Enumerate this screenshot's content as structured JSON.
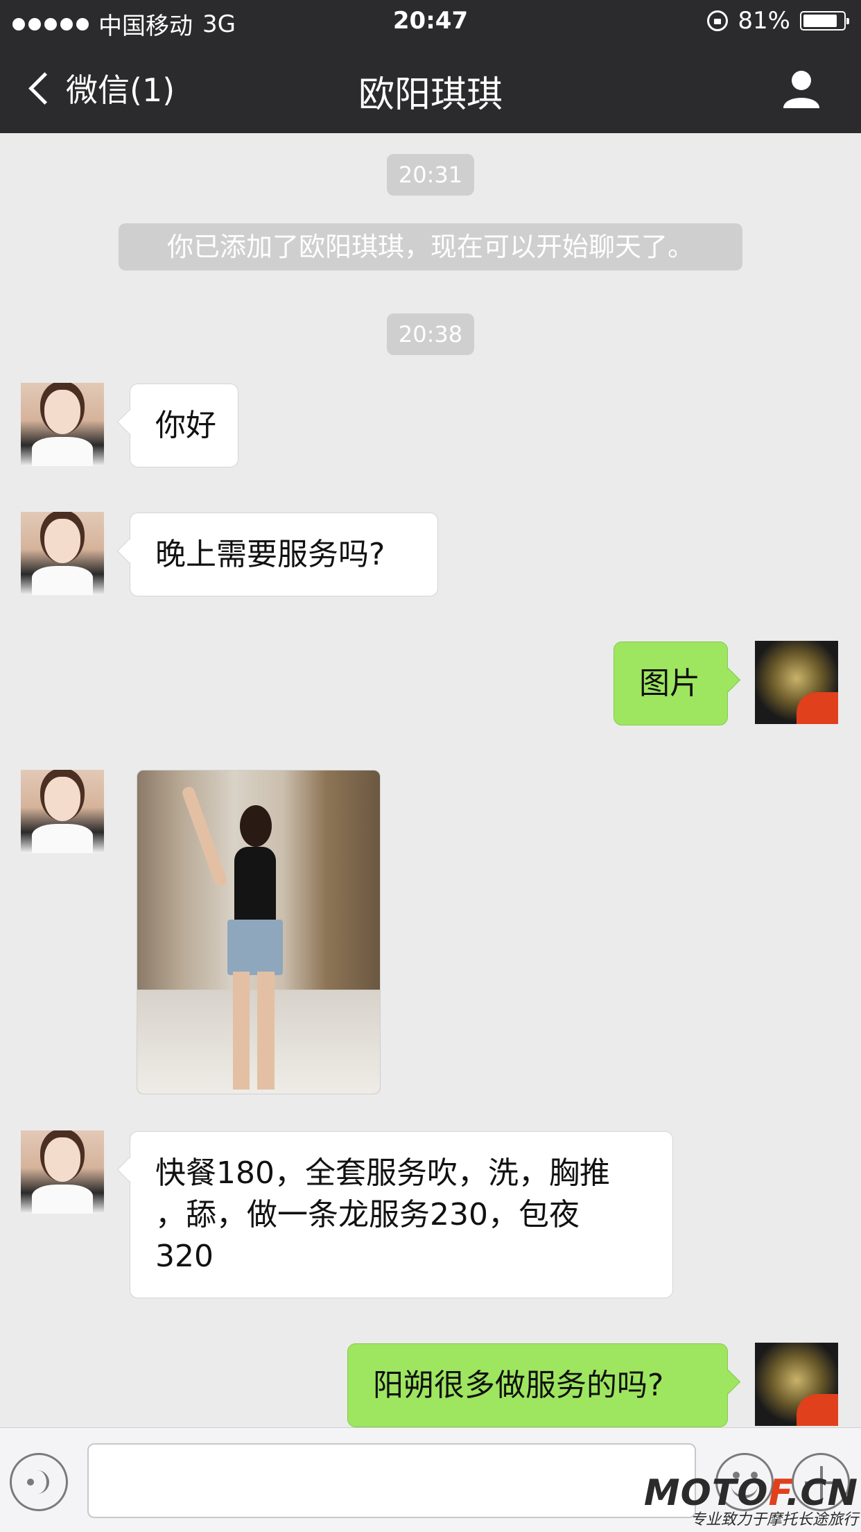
{
  "status_bar": {
    "carrier": "中国移动",
    "network": "3G",
    "time": "20:47",
    "battery": "81%"
  },
  "nav": {
    "back_label": "微信(1)",
    "title": "欧阳琪琪"
  },
  "messages": {
    "ts1": "20:31",
    "system": "你已添加了欧阳琪琪，现在可以开始聊天了。",
    "ts2": "20:38",
    "m1": "你好",
    "m2": "晚上需要服务吗?",
    "m3": "图片",
    "m5_line1": "快餐180，全套服务吹，洗，胸推",
    "m5_line2": "，舔，做一条龙服务230，包夜",
    "m5_line3": "320",
    "m6": "阳朔很多做服务的吗?"
  },
  "input_bar": {
    "placeholder": ""
  },
  "watermark": {
    "brand_a": "MOTO",
    "brand_f": "F",
    "brand_b": ".CN",
    "slogan": "专业致力于摩托长途旅行"
  },
  "colors": {
    "nav_bg": "#2b2b2d",
    "chat_bg": "#ebebeb",
    "outgoing_bubble": "#9ee660",
    "incoming_bubble": "#ffffff"
  }
}
